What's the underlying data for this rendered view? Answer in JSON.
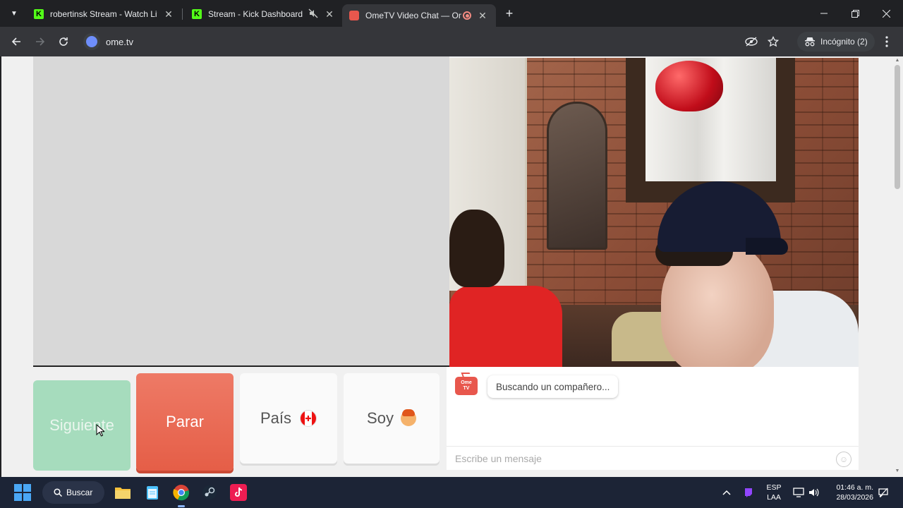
{
  "browser": {
    "tabs": [
      {
        "title": "robertinsk Stream - Watch Live",
        "close": "✕",
        "active": false
      },
      {
        "title": "Stream - Kick Dashboard",
        "close": "✕",
        "active": false
      },
      {
        "title": "OmeTV Video Chat — Ome",
        "close": "✕",
        "active": true
      }
    ],
    "new_tab_label": "+",
    "url": "ome.tv",
    "incognito_label": "Incógnito (2)",
    "colors": {
      "frame": "#202124",
      "toolbar": "#35363a",
      "kick_green": "#53fc18"
    }
  },
  "page": {
    "buttons": {
      "next_label": "Siguiente",
      "stop_label": "Parar",
      "country_label": "País",
      "soy_label": "Soy"
    },
    "chat": {
      "logo_line1": "Ome",
      "logo_line2": "TV",
      "status_message": "Buscando un compañero...",
      "input_placeholder": "Escribe un mensaje"
    },
    "colors": {
      "next": "#a6dcbd",
      "stop": "#e86a53",
      "logo": "#e8574d"
    }
  },
  "taskbar": {
    "search_label": "Buscar",
    "lang_line1": "ESP",
    "lang_line2": "LAA",
    "time": "01:46 a. m.",
    "date": "28/03/2026"
  }
}
